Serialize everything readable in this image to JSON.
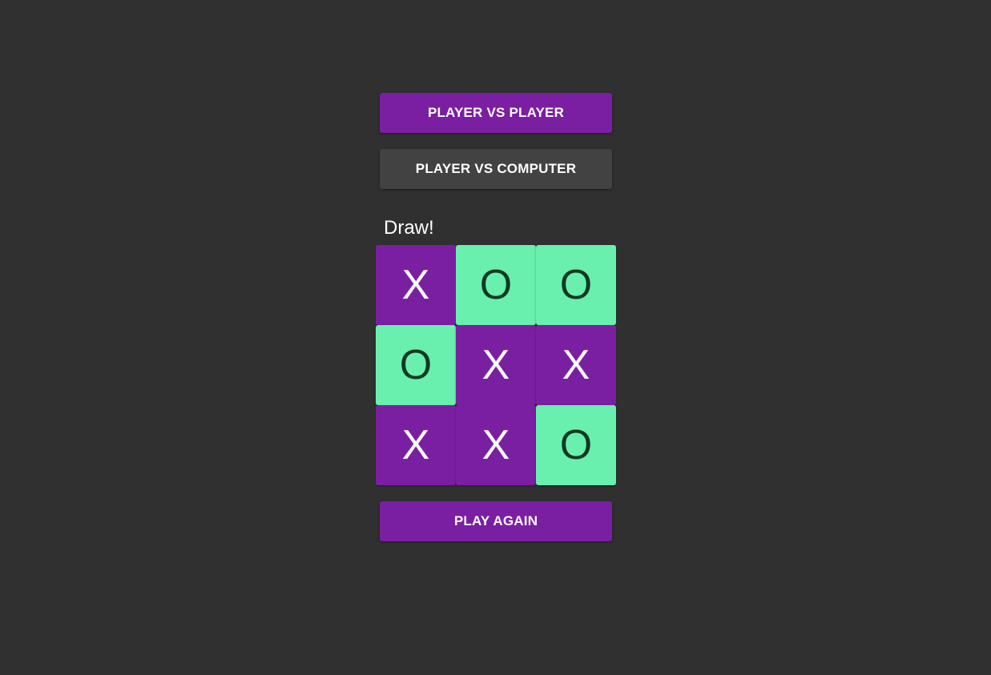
{
  "modes": {
    "pvp_label": "PLAYER VS PLAYER",
    "pvc_label": "PLAYER VS COMPUTER",
    "selected": "pvp"
  },
  "status": "Draw!",
  "board": [
    [
      "X",
      "O",
      "O"
    ],
    [
      "O",
      "X",
      "X"
    ],
    [
      "X",
      "X",
      "O"
    ]
  ],
  "play_again_label": "PLAY AGAIN",
  "colors": {
    "background": "#303030",
    "accent": "#7b1fa2",
    "secondary_button": "#424242",
    "o_cell": "#69f0ae",
    "o_text": "#123824",
    "x_text": "#ffffff"
  }
}
